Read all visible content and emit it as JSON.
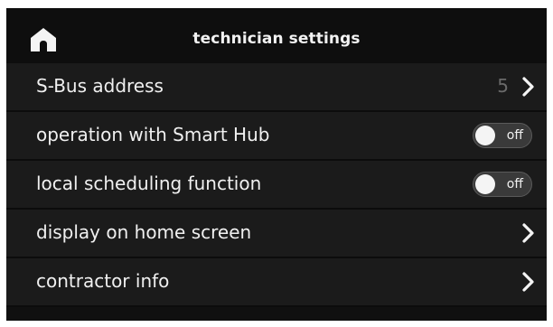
{
  "header": {
    "title": "technician settings",
    "home_icon": "home-icon"
  },
  "colors": {
    "background": "#101010",
    "row_background": "#1b1b1b",
    "text": "#f0f0f0",
    "value_text": "#6a6a6a",
    "toggle_off": "#3a3a3a"
  },
  "rows": [
    {
      "label": "S-Bus address",
      "value": "5",
      "control": "chevron"
    },
    {
      "label": "operation with Smart Hub",
      "toggle_state": "off",
      "control": "toggle"
    },
    {
      "label": "local scheduling function",
      "toggle_state": "off",
      "control": "toggle"
    },
    {
      "label": "display on home screen",
      "control": "chevron"
    },
    {
      "label": "contractor info",
      "control": "chevron"
    }
  ]
}
